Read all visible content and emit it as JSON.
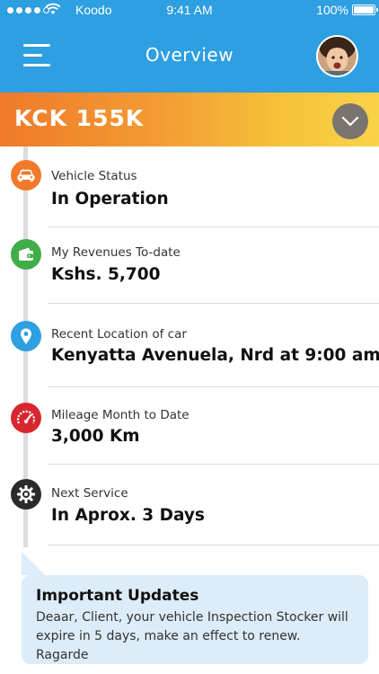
{
  "status_bar": {
    "carrier": "Koodo",
    "time": "9:41 AM",
    "battery": "100%"
  },
  "nav": {
    "title": "Overview"
  },
  "vehicle": {
    "plate": "KCK 155K"
  },
  "items": [
    {
      "label": "Vehicle Status",
      "value": "In Operation",
      "icon": "car-icon",
      "color": "#f07a2a"
    },
    {
      "label": "My Revenues To-date",
      "value": "Kshs. 5,700",
      "icon": "wallet-icon",
      "color": "#3fae49"
    },
    {
      "label": "Recent Location of car",
      "value": "Kenyatta Avenuela, Nrd at 9:00 am",
      "icon": "location-pin-icon",
      "color": "#2e9fe0"
    },
    {
      "label": "Mileage Month to Date",
      "value": "3,000 Km",
      "icon": "speedometer-icon",
      "color": "#d8262f"
    },
    {
      "label": "Next Service",
      "value": "In Aprox. 3 Days",
      "icon": "gear-icon",
      "color": "#2b2b2b"
    }
  ],
  "updates": {
    "title": "Important Updates",
    "body": "Deaar, Client, your vehicle Inspection Stocker will expire in 5 days, make an effect to renew. Ragarde"
  }
}
